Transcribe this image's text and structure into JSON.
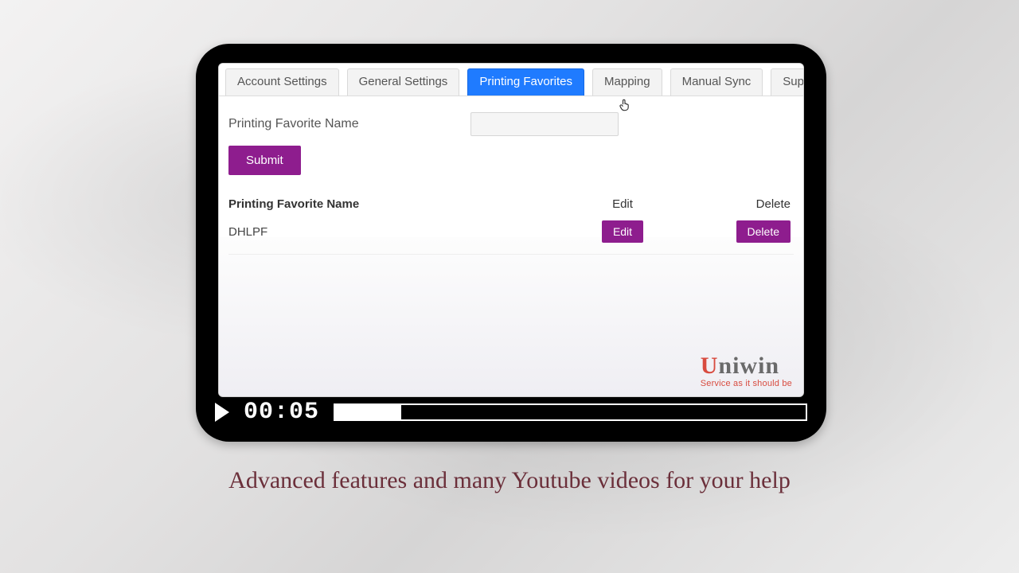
{
  "tabs": [
    {
      "label": "Account Settings"
    },
    {
      "label": "General Settings"
    },
    {
      "label": "Printing Favorites"
    },
    {
      "label": "Mapping"
    },
    {
      "label": "Manual Sync"
    },
    {
      "label": "Support"
    }
  ],
  "active_tab_index": 2,
  "form": {
    "label": "Printing Favorite Name",
    "value": "",
    "submit": "Submit"
  },
  "table": {
    "headers": {
      "name": "Printing Favorite Name",
      "edit": "Edit",
      "del": "Delete"
    },
    "rows": [
      {
        "name": "DHLPF",
        "edit": "Edit",
        "del": "Delete"
      }
    ]
  },
  "logo": {
    "main_pre": "U",
    "main_rest": "niwin",
    "sub": "Service as it should be"
  },
  "player": {
    "time": "00:05",
    "progress_percent": 14
  },
  "caption": "Advanced features and many Youtube videos for your help"
}
